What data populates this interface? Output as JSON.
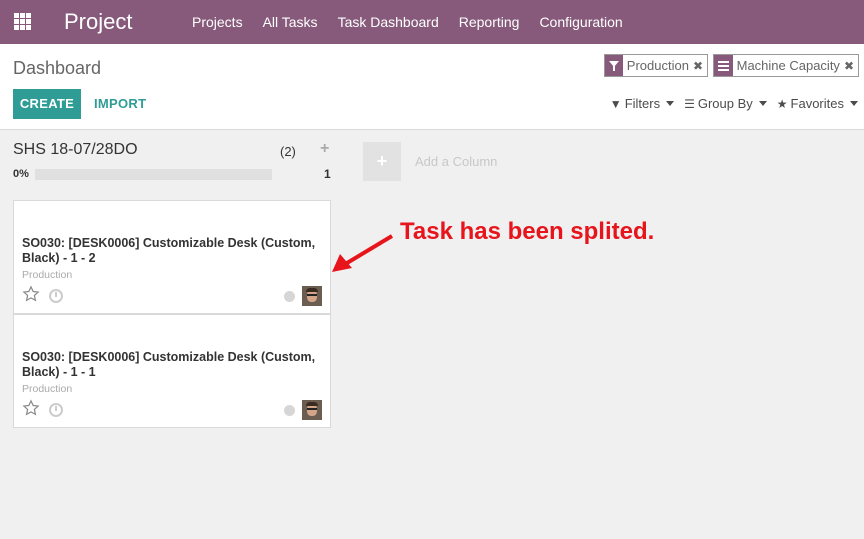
{
  "navbar": {
    "brand": "Project",
    "menu": [
      "Projects",
      "All Tasks",
      "Task Dashboard",
      "Reporting",
      "Configuration"
    ]
  },
  "control_panel": {
    "breadcrumb": "Dashboard",
    "create_label": "CREATE",
    "import_label": "IMPORT",
    "facets": [
      {
        "icon": "filter-icon",
        "label": "Production"
      },
      {
        "icon": "group-by-icon",
        "label": "Machine Capacity"
      }
    ],
    "filters_label": "Filters",
    "group_by_label": "Group By",
    "favorites_label": "Favorites"
  },
  "column": {
    "title": "SHS 18-07/28DO",
    "count": "(2)",
    "add": "+",
    "progress_label": "0%",
    "progress": 0,
    "total": "1"
  },
  "add_column": {
    "icon": "+",
    "label": "Add a Column"
  },
  "cards": [
    {
      "title": "SO030: [DESK0006] Customizable Desk (Custom, Black) - 1 - 2",
      "tag": "Production"
    },
    {
      "title": "SO030: [DESK0006] Customizable Desk (Custom, Black) - 1 - 1",
      "tag": "Production"
    }
  ],
  "annotation": {
    "text": "Task has been splited.",
    "color": "#e8141c"
  },
  "colors": {
    "navbar": "#875a7b",
    "primary_button": "#2f9c96"
  }
}
